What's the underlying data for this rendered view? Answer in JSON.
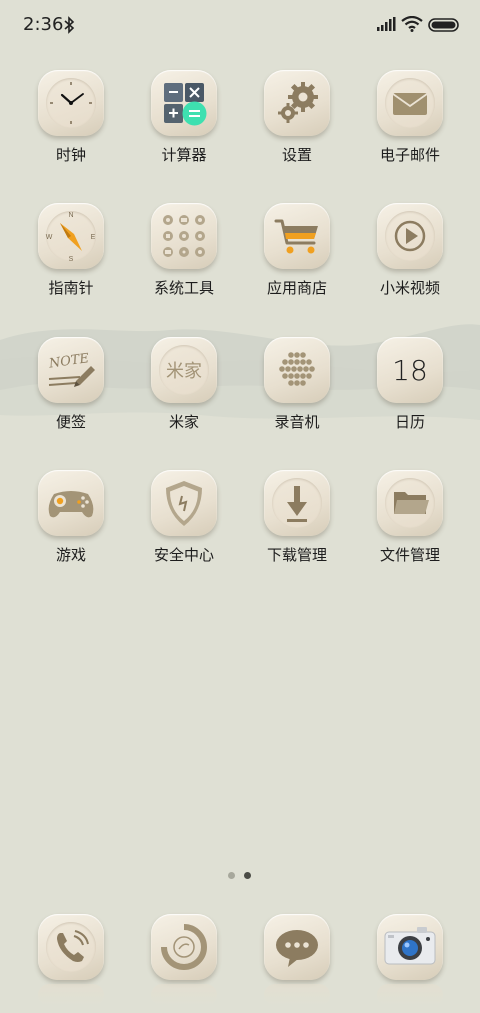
{
  "status_bar": {
    "time": "2:36",
    "icons": [
      "bluetooth-icon",
      "signal-icon",
      "wifi-icon",
      "battery-icon"
    ]
  },
  "apps": [
    {
      "label": "时钟",
      "icon": "clock-icon"
    },
    {
      "label": "计算器",
      "icon": "calculator-icon"
    },
    {
      "label": "设置",
      "icon": "gear-icon"
    },
    {
      "label": "电子邮件",
      "icon": "mail-icon"
    },
    {
      "label": "指南针",
      "icon": "compass-icon"
    },
    {
      "label": "系统工具",
      "icon": "tools-folder-icon"
    },
    {
      "label": "应用商店",
      "icon": "shopping-cart-icon"
    },
    {
      "label": "小米视频",
      "icon": "play-icon"
    },
    {
      "label": "便签",
      "icon": "note-icon",
      "icon_text": "NOTE"
    },
    {
      "label": "米家",
      "icon": "mijia-icon",
      "icon_text": "米家"
    },
    {
      "label": "录音机",
      "icon": "recorder-icon"
    },
    {
      "label": "日历",
      "icon": "calendar-icon",
      "icon_text": "18"
    },
    {
      "label": "游戏",
      "icon": "gamepad-icon"
    },
    {
      "label": "安全中心",
      "icon": "shield-icon"
    },
    {
      "label": "下载管理",
      "icon": "download-icon"
    },
    {
      "label": "文件管理",
      "icon": "folder-icon"
    }
  ],
  "compass_letters": {
    "n": "N",
    "e": "E",
    "s": "S",
    "w": "W"
  },
  "page_indicator": {
    "count": 2,
    "active": 2
  },
  "dock": [
    {
      "icon": "phone-icon"
    },
    {
      "icon": "browser-icon"
    },
    {
      "icon": "messages-icon"
    },
    {
      "icon": "camera-icon"
    }
  ],
  "colors": {
    "background": "#dfe0d4",
    "tile": "#ebe3d4",
    "icon_brown": "#8c7c60",
    "accent_teal": "#3ee0b0",
    "accent_orange": "#f0a020",
    "camera_blue": "#2f74c8"
  }
}
